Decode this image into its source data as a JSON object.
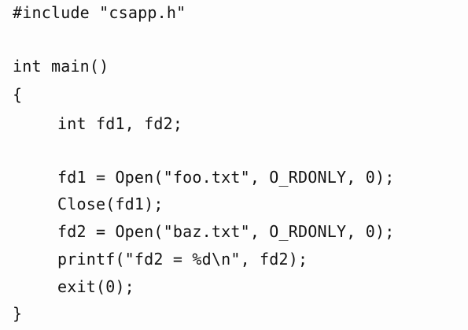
{
  "code": {
    "lines": [
      "#include \"csapp.h\"",
      "",
      "int main()",
      "{",
      "int fd1, fd2;",
      "",
      "fd1 = Open(\"foo.txt\", O_RDONLY, 0);",
      "Close(fd1);",
      "fd2 = Open(\"baz.txt\", O_RDONLY, 0);",
      "printf(\"fd2 = %d\\n\", fd2);",
      "exit(0);",
      "}"
    ]
  }
}
